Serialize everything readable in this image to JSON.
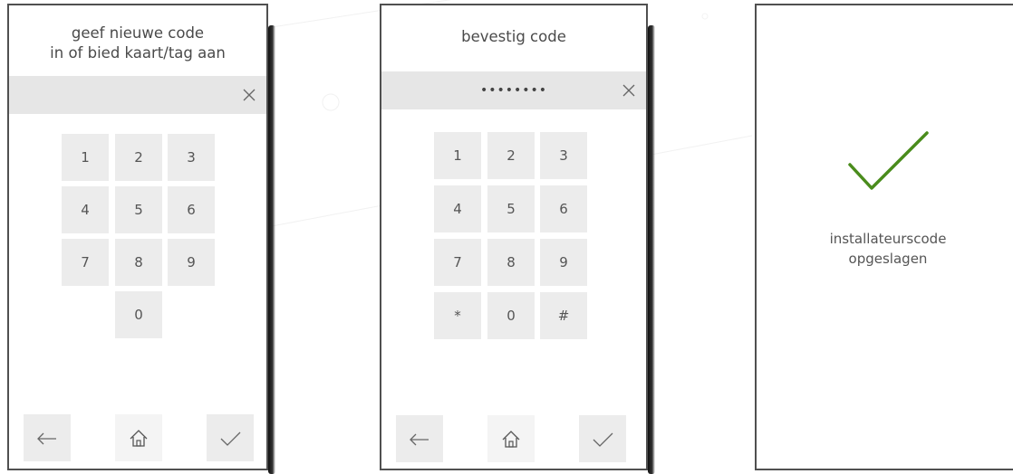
{
  "screens": [
    {
      "title": "geef nieuwe code\nin of bied kaart/tag aan",
      "code_display": "",
      "keys": [
        "1",
        "2",
        "3",
        "4",
        "5",
        "6",
        "7",
        "8",
        "9",
        "0"
      ],
      "footer_icons": [
        "arrow-left-icon",
        "home-icon",
        "check-icon"
      ]
    },
    {
      "title": "bevestig code",
      "code_display": "••••••••",
      "keys": [
        "1",
        "2",
        "3",
        "4",
        "5",
        "6",
        "7",
        "8",
        "9",
        "*",
        "0",
        "#"
      ],
      "footer_icons": [
        "arrow-left-icon",
        "home-icon",
        "check-icon"
      ]
    },
    {
      "message": "installateurscode\nopgeslagen",
      "icon": "check-icon",
      "accent": "#4a8c1c"
    }
  ],
  "colors": {
    "frame": "#505050",
    "code_bar": "#e6e6e6",
    "key_bg": "#ececec",
    "text": "#4a4a4a"
  }
}
